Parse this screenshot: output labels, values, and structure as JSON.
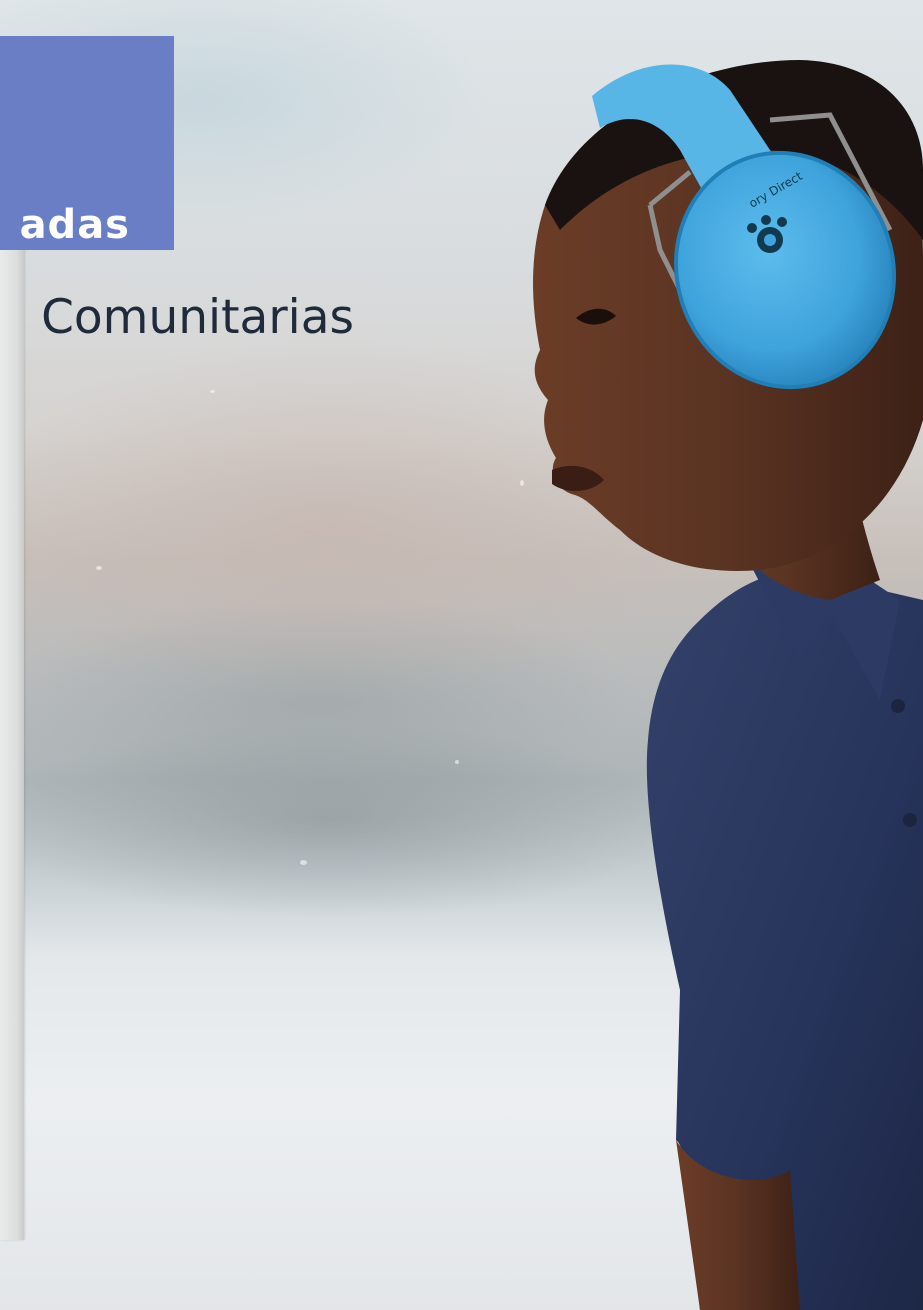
{
  "slide": {
    "title_fragment": "adas",
    "subtitle_fragment": "Comunitarias"
  },
  "photo": {
    "subject": "child-with-blue-earmuffs",
    "headphone_print": "ory Direct"
  },
  "colors": {
    "title_tile": "#6a7ec5",
    "earmuff_blue": "#3fa3dc",
    "shirt_navy": "#26335a",
    "skin": "#5a3322"
  }
}
